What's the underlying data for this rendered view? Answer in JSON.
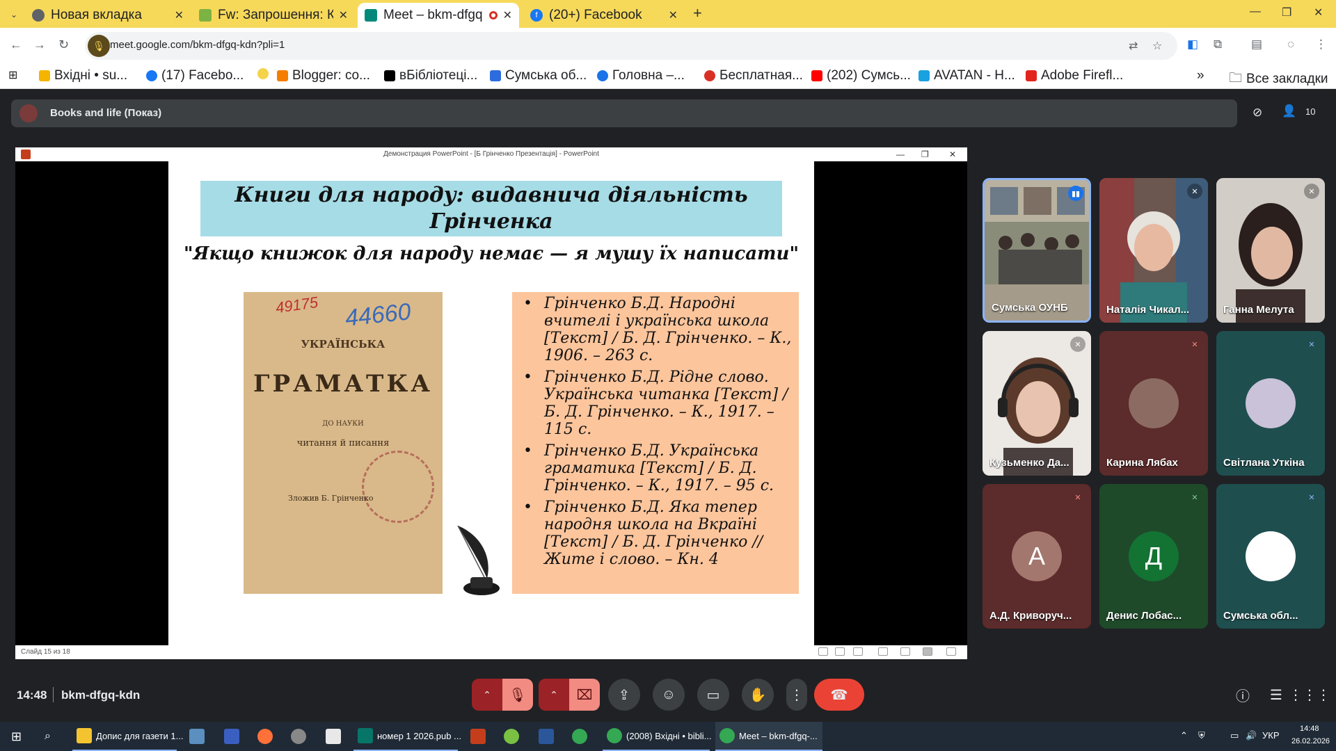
{
  "browser": {
    "tabs": [
      {
        "title": "Новая вкладка",
        "active": false
      },
      {
        "title": "Fw: Запрошення: К",
        "active": false
      },
      {
        "title": "Meet – bkm-dfgq",
        "active": true
      },
      {
        "title": "(20+) Facebook",
        "active": false
      }
    ],
    "new_tab": "+",
    "url": "meet.google.com/bkm-dfgq-kdn?pli=1",
    "bookmarks": [
      {
        "label": "Вхідні • su...",
        "color": "#f4b400"
      },
      {
        "label": "(17) Facebo...",
        "color": "#1877f2"
      },
      {
        "label": "",
        "color": "#f4b400"
      },
      {
        "label": "Blogger: co...",
        "color": "#f57d00"
      },
      {
        "label": "вБібліотеці...",
        "color": "#000000"
      },
      {
        "label": "Сумська об...",
        "color": "#2d6cdf"
      },
      {
        "label": "Головна –...",
        "color": "#1a73e8"
      },
      {
        "label": "Бесплатная...",
        "color": "#d93025"
      },
      {
        "label": "(202) Сумсь...",
        "color": "#ff0000"
      },
      {
        "label": "AVATAN - Н...",
        "color": "#1aa1e0"
      },
      {
        "label": "Adobe Firefl...",
        "color": "#e1251b"
      }
    ],
    "bookmarks_more": "»",
    "all_bookmarks": "Все закладки"
  },
  "meet": {
    "room_title": "Books and life (Показ)",
    "participants_count": "10",
    "time": "14:48",
    "meeting_code": "bkm-dfgq-kdn"
  },
  "powerpoint": {
    "window_title": "Демонстрация PowerPoint - [Б Грінченко Презентація] - PowerPoint",
    "status": "Слайд 15 из 18"
  },
  "slide": {
    "heading": "Книги для народу: видавнича діяльність Грінченка",
    "quote": "\"Якщо книжок для народу немає — я мушу їх написати\"",
    "book_cover": {
      "line1": "УКРАЇНСЬКА",
      "title": "ГРАМАТКА",
      "line2": "ДО НАУКИ",
      "line3": "читання й писання",
      "line4": "Зложив Б. Грінченко",
      "stamp_numbers": "44660",
      "stamp_left": "49175"
    },
    "bibliography": [
      "Грінченко Б.Д. Народні вчителі і українська школа [Текст] / Б. Д. Грінченко. – К., 1906. – 263 с.",
      "Грінченко Б.Д. Рідне слово. Українська читанка [Текст] / Б. Д. Грінченко. – К., 1917. – 115 с.",
      "Грінченко Б.Д. Українська граматика [Текст] / Б. Д. Грінченко. – К., 1917. – 95 с.",
      "Грінченко Б.Д. Яка тепер народня школа на Вкраїні [Текст] / Б. Д. Грінченко // Жите і слово. – Кн. 4"
    ]
  },
  "participants": [
    {
      "name": "Сумська ОУНБ",
      "mic": "speaking",
      "bg": "#6b6f5a",
      "letter": ""
    },
    {
      "name": "Наталія Чикал...",
      "mic": "muted",
      "bg": "#7a5f55",
      "letter": ""
    },
    {
      "name": "Ганна Мелута",
      "mic": "muted",
      "bg": "#a89f98",
      "letter": ""
    },
    {
      "name": "Кузьменко Да...",
      "mic": "muted",
      "bg": "#cbbfb4",
      "letter": ""
    },
    {
      "name": "Карина Лябах",
      "mic": "muted-red",
      "bg": "#5c2b2b",
      "letter": ""
    },
    {
      "name": "Світлана Уткіна",
      "mic": "muted-teal",
      "bg": "#1f4e4f",
      "letter": ""
    },
    {
      "name": "А.Д. Криворуч...",
      "mic": "muted-red",
      "bg": "#5c2b2b",
      "letter": "А",
      "letter_bg": "#a3776e"
    },
    {
      "name": "Денис Лобас...",
      "mic": "muted-green",
      "bg": "#1e4a2a",
      "letter": "Д",
      "letter_bg": "#137333"
    },
    {
      "name": "Сумська обл...",
      "mic": "muted-teal",
      "bg": "#1f4e4f",
      "letter": ""
    }
  ],
  "controls": [
    "more-audio",
    "mic-off",
    "more-video",
    "camera-off",
    "present",
    "emoji",
    "captions",
    "raise-hand",
    "more",
    "leave-call"
  ],
  "taskbar": {
    "items": [
      {
        "label": "Допис для газети 1...",
        "color": "#f4c430",
        "open": true
      },
      {
        "label": "",
        "color": "#5a8fbf",
        "open": false
      },
      {
        "label": "",
        "color": "#3b5fc0",
        "open": false
      },
      {
        "label": "",
        "color": "#ff7139",
        "open": false
      },
      {
        "label": "",
        "color": "#888888",
        "open": false
      },
      {
        "label": "",
        "color": "#e8e8e8",
        "open": false
      },
      {
        "label": "номер 1 2026.pub ...",
        "color": "#077568",
        "open": true
      },
      {
        "label": "",
        "color": "#c43e1c",
        "open": false
      },
      {
        "label": "",
        "color": "#7ac143",
        "open": false
      },
      {
        "label": "",
        "color": "#2b579a",
        "open": false
      },
      {
        "label": "",
        "color": "#34a853",
        "open": false
      },
      {
        "label": "(2008) Вхідні • bibli...",
        "color": "#34a853",
        "open": true
      },
      {
        "label": "Meet – bkm-dfgq-...",
        "color": "#34a853",
        "open": true
      }
    ],
    "lang": "УКР",
    "clock_time": "14:48",
    "clock_date": "26.02.2026"
  }
}
